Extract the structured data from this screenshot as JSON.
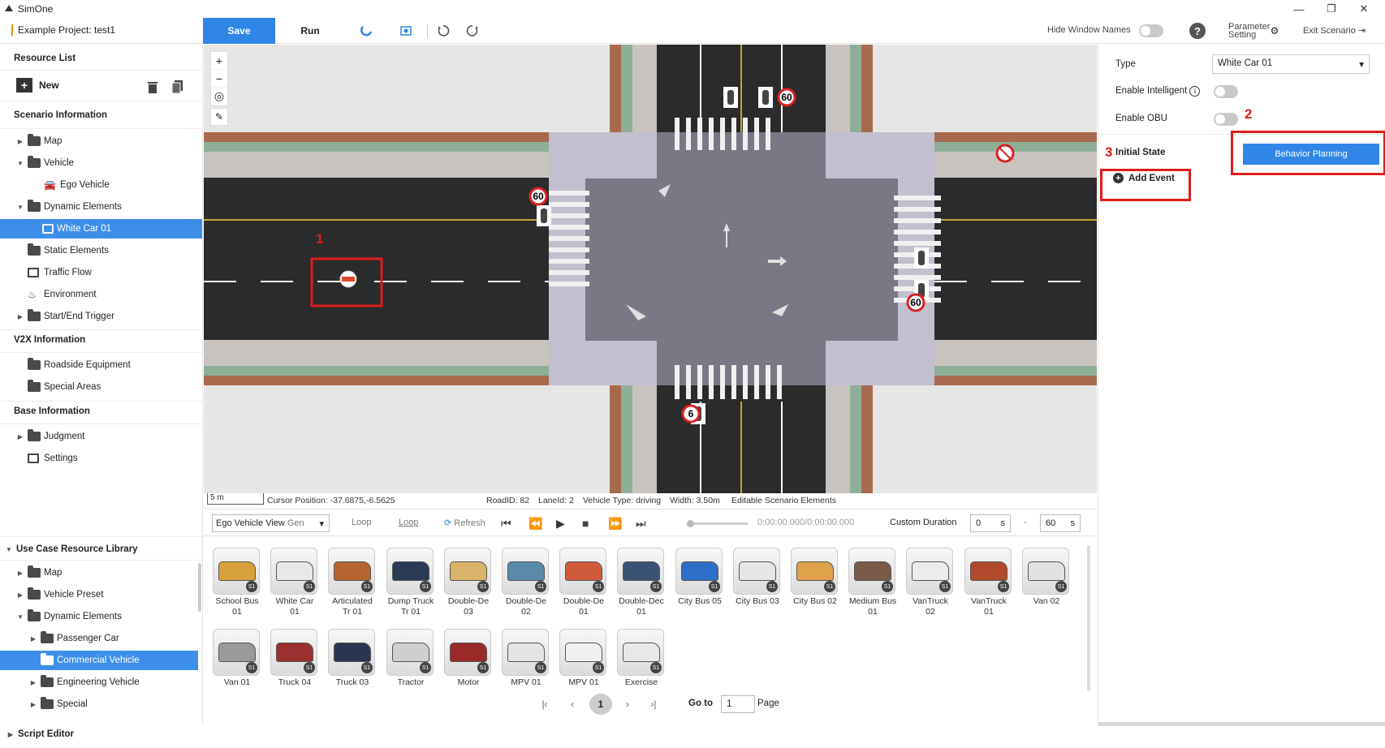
{
  "app": {
    "title": "SimOne",
    "window_controls": [
      "—",
      "❐",
      "✕"
    ]
  },
  "toolbar": {
    "project": "Example Project: test1",
    "save_label": "Save",
    "run_label": "Run",
    "hide_window_names": "Hide Window Names",
    "help": "?",
    "parameter_setting_1": "Parameter",
    "parameter_setting_2": "Setting",
    "exit_scenario": "Exit Scenario"
  },
  "left_panel": {
    "resource_list": "Resource List",
    "new_label": "New",
    "scenario_info": "Scenario Information",
    "scenario_items": [
      {
        "label": "Map"
      },
      {
        "label": "Vehicle"
      },
      {
        "label": "Ego Vehicle"
      },
      {
        "label": "Dynamic Elements"
      },
      {
        "label": "White Car 01"
      },
      {
        "label": "Static Elements"
      },
      {
        "label": "Traffic Flow"
      },
      {
        "label": "Environment"
      },
      {
        "label": "Start/End Trigger"
      }
    ],
    "v2x_info": "V2X Information",
    "v2x_items": [
      {
        "label": "Roadside Equipment"
      },
      {
        "label": "Special Areas"
      }
    ],
    "base_info": "Base Information",
    "base_items": [
      {
        "label": "Judgment"
      },
      {
        "label": "Settings"
      }
    ],
    "use_case_library": "Use Case Resource Library",
    "library_items": [
      {
        "label": "Map"
      },
      {
        "label": "Vehicle Preset"
      },
      {
        "label": "Dynamic Elements"
      },
      {
        "label": "Passenger Car"
      },
      {
        "label": "Commercial Vehicle"
      },
      {
        "label": "Engineering Vehicle"
      },
      {
        "label": "Special"
      }
    ],
    "script_editor": "Script Editor"
  },
  "map": {
    "zoom_in": "+",
    "zoom_out": "−",
    "speed_signs": [
      "60",
      "60",
      "60",
      "6"
    ],
    "annotation_1": "1"
  },
  "status": {
    "scale": "5 m",
    "cursor_position": "Cursor Position: -37.6875,-6.5625",
    "road_id": "RoadID: 82",
    "lane_id": "LaneId: 2",
    "vehicle_type": "Vehicle Type: driving",
    "width": "Width: 3.50m",
    "editable": "Editable Scenario Elements"
  },
  "playbar": {
    "view": "Ego Vehicle View",
    "view_suffix": "Gen",
    "loop": "Loop",
    "loop2": "Loop",
    "refresh": "Refresh",
    "time": "0:00:00.000/0:00:00.000",
    "custom_duration": "Custom Duration",
    "duration_start": "0",
    "duration_end": "60",
    "unit": "s",
    "dash": "-"
  },
  "library": [
    {
      "line1": "School Bus",
      "line2": "01",
      "color": "#d8a13a"
    },
    {
      "line1": "White Car",
      "line2": "01",
      "color": "#e8e8e8"
    },
    {
      "line1": "Articulated",
      "line2": "Tr 01",
      "color": "#b5652f"
    },
    {
      "line1": "Dump Truck",
      "line2": "Tr 01",
      "color": "#2a3a55"
    },
    {
      "line1": "Double-De",
      "line2": "03",
      "color": "#d9b36a"
    },
    {
      "line1": "Double-De",
      "line2": "02",
      "color": "#5a8aa8"
    },
    {
      "line1": "Double-De",
      "line2": "01",
      "color": "#cf5a3c"
    },
    {
      "line1": "Double-Dec",
      "line2": "01",
      "color": "#3b5272"
    },
    {
      "line1": "City Bus 05",
      "line2": "",
      "color": "#2d6fc9"
    },
    {
      "line1": "City Bus 03",
      "line2": "",
      "color": "#e6e6e6"
    },
    {
      "line1": "City Bus 02",
      "line2": "",
      "color": "#dfa24a"
    },
    {
      "line1": "Medium Bus",
      "line2": "01",
      "color": "#7a5a4a"
    },
    {
      "line1": "VanTruck",
      "line2": "02",
      "color": "#ececec"
    },
    {
      "line1": "VanTruck",
      "line2": "01",
      "color": "#b04a2a"
    },
    {
      "line1": "Van 02",
      "line2": "",
      "color": "#e2e2e2"
    },
    {
      "line1": "Van 01",
      "line2": "",
      "color": "#9a9a9a"
    },
    {
      "line1": "Truck 04",
      "line2": "",
      "color": "#9a3030"
    },
    {
      "line1": "Truck 03",
      "line2": "",
      "color": "#2a3550"
    },
    {
      "line1": "Tractor",
      "line2": "",
      "color": "#cfcfcf"
    },
    {
      "line1": "Motor",
      "line2": "",
      "color": "#9a2a2a"
    },
    {
      "line1": "MPV 01",
      "line2": "",
      "color": "#e4e4e4"
    },
    {
      "line1": "MPV 01",
      "line2": "",
      "color": "#f0f0f0"
    },
    {
      "line1": "Exercise",
      "line2": "",
      "color": "#e8e8e8"
    }
  ],
  "library_badge": "S1",
  "pagination": {
    "first": "|‹",
    "prev": "‹",
    "current": "1",
    "next": "›",
    "last": "›|",
    "goto": "Go to",
    "page_value": "1",
    "page": "Page"
  },
  "right_panel": {
    "type_label": "Type",
    "type_value": "White Car 01",
    "enable_intelligent": "Enable Intelligent",
    "enable_obu": "Enable OBU",
    "initial_state": "Initial State",
    "behavior_planning": "Behavior Planning",
    "add_event": "Add Event",
    "annotation_2": "2",
    "annotation_3": "3"
  }
}
